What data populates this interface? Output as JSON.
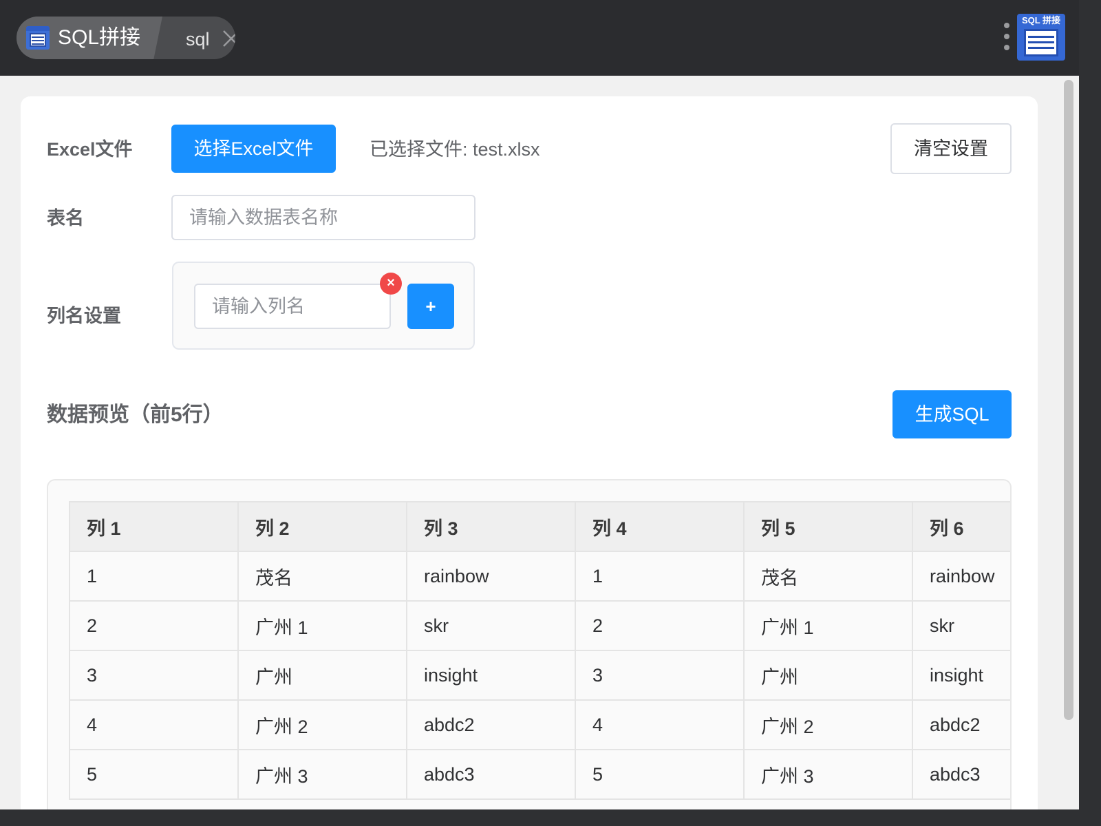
{
  "titlebar": {
    "app_title": "SQL拼接",
    "tab_label": "sql",
    "app_icon_label": "SQL 拼接",
    "icons": {
      "app": "spreadsheet-icon",
      "close": "close-icon",
      "more": "more-vertical-icon"
    }
  },
  "form": {
    "excel_label": "Excel文件",
    "select_button": "选择Excel文件",
    "selected_file": "已选择文件: test.xlsx",
    "clear_button": "清空设置",
    "table_name_label": "表名",
    "table_name_placeholder": "请输入数据表名称",
    "table_name_value": "",
    "column_settings_label": "列名设置",
    "column_placeholder": "请输入列名",
    "column_value": "",
    "remove_symbol": "×",
    "add_symbol": "+"
  },
  "preview": {
    "title": "数据预览（前5行）",
    "generate_button": "生成SQL",
    "headers": [
      "列 1",
      "列 2",
      "列 3",
      "列 4",
      "列 5",
      "列 6"
    ],
    "rows": [
      [
        "1",
        "茂名",
        "rainbow",
        "1",
        "茂名",
        "rainbow"
      ],
      [
        "2",
        "广州 1",
        "skr",
        "2",
        "广州 1",
        "skr"
      ],
      [
        "3",
        "广州",
        "insight",
        "3",
        "广州",
        "insight"
      ],
      [
        "4",
        "广州 2",
        "abdc2",
        "4",
        "广州 2",
        "abdc2"
      ],
      [
        "5",
        "广州 3",
        "abdc3",
        "5",
        "广州 3",
        "abdc3"
      ]
    ]
  },
  "colors": {
    "primary": "#1890ff",
    "danger": "#f04848",
    "titlebar_bg": "#2b2c2f"
  }
}
